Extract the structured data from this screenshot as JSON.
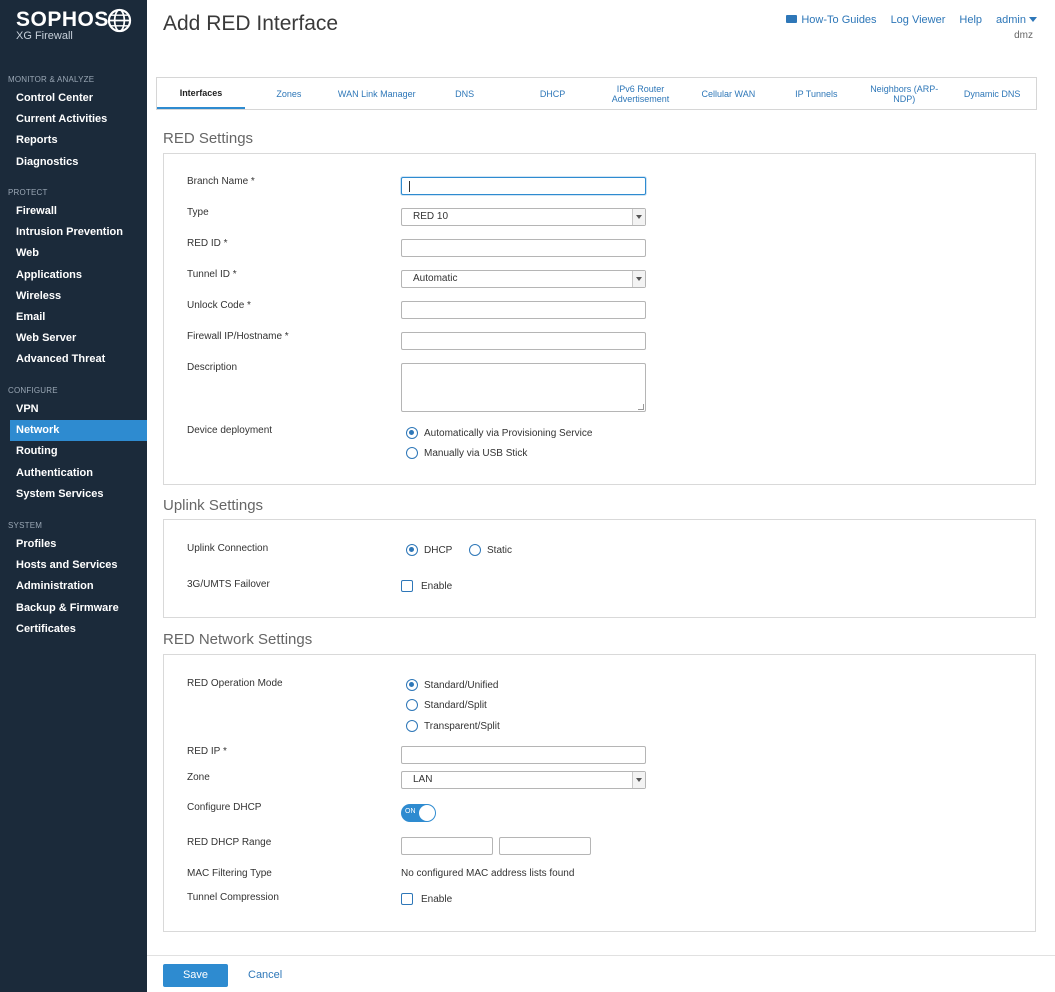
{
  "app": {
    "logo": "SOPHOS",
    "product": "XG Firewall"
  },
  "header": {
    "title": "Add RED Interface",
    "links": [
      "How-To Guides",
      "Log Viewer",
      "Help"
    ],
    "user": "admin",
    "context": "dmz"
  },
  "sidebar": {
    "sections": [
      {
        "title": "MONITOR & ANALYZE",
        "items": [
          "Control Center",
          "Current Activities",
          "Reports",
          "Diagnostics"
        ]
      },
      {
        "title": "PROTECT",
        "items": [
          "Firewall",
          "Intrusion Prevention",
          "Web",
          "Applications",
          "Wireless",
          "Email",
          "Web Server",
          "Advanced Threat"
        ]
      },
      {
        "title": "CONFIGURE",
        "items": [
          "VPN",
          "Network",
          "Routing",
          "Authentication",
          "System Services"
        ]
      },
      {
        "title": "SYSTEM",
        "items": [
          "Profiles",
          "Hosts and Services",
          "Administration",
          "Backup & Firmware",
          "Certificates"
        ]
      }
    ],
    "active": "Network"
  },
  "tabs": [
    "Interfaces",
    "Zones",
    "WAN Link Manager",
    "DNS",
    "DHCP",
    "IPv6 Router Advertisement",
    "Cellular WAN",
    "IP Tunnels",
    "Neighbors (ARP-NDP)",
    "Dynamic DNS"
  ],
  "active_tab": "Interfaces",
  "red_settings": {
    "title": "RED Settings",
    "branch_name_label": "Branch Name *",
    "branch_name_value": "",
    "type_label": "Type",
    "type_value": "RED 10",
    "red_id_label": "RED ID *",
    "red_id_value": "",
    "tunnel_id_label": "Tunnel ID *",
    "tunnel_id_value": "Automatic",
    "unlock_code_label": "Unlock Code *",
    "unlock_code_value": "",
    "firewall_ip_label": "Firewall IP/Hostname *",
    "firewall_ip_value": "",
    "description_label": "Description",
    "description_value": "",
    "deployment_label": "Device deployment",
    "deployment_options": [
      "Automatically via Provisioning Service",
      "Manually via USB Stick"
    ],
    "deployment_selected": 0
  },
  "uplink_settings": {
    "title": "Uplink Settings",
    "uplink_label": "Uplink Connection",
    "uplink_options": [
      "DHCP",
      "Static"
    ],
    "uplink_selected": 0,
    "failover_label": "3G/UMTS Failover",
    "failover_checkbox": "Enable",
    "failover_checked": false
  },
  "red_network": {
    "title": "RED Network Settings",
    "mode_label": "RED Operation Mode",
    "mode_options": [
      "Standard/Unified",
      "Standard/Split",
      "Transparent/Split"
    ],
    "mode_selected": 0,
    "red_ip_label": "RED IP *",
    "red_ip_value": "",
    "zone_label": "Zone",
    "zone_value": "LAN",
    "dhcp_label": "Configure DHCP",
    "dhcp_toggle_text": "ON",
    "dhcp_on": true,
    "range_label": "RED DHCP Range",
    "range_start": "",
    "range_end": "",
    "mac_label": "MAC Filtering Type",
    "mac_value": "No configured MAC address lists found",
    "compression_label": "Tunnel Compression",
    "compression_checkbox": "Enable",
    "compression_checked": false
  },
  "footer": {
    "save": "Save",
    "cancel": "Cancel"
  },
  "colors": {
    "sidebar_bg": "#1b2a3a",
    "accent": "#2e8bd0",
    "link": "#2e77b8"
  }
}
